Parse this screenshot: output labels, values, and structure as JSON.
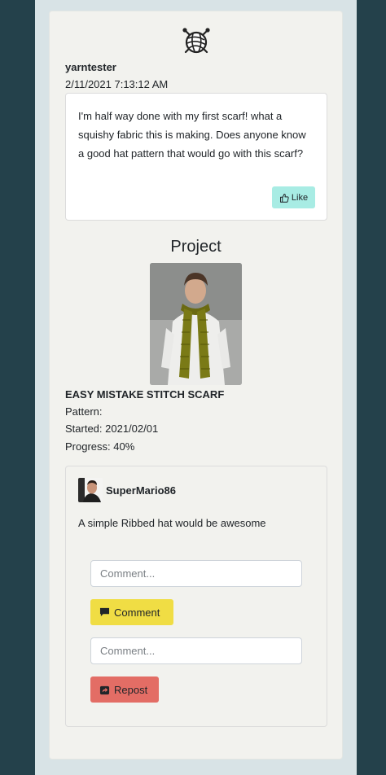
{
  "post": {
    "username": "yarntester",
    "timestamp": "2/11/2021 7:13:12 AM",
    "text": "I'm half way done with my first scarf! what a squishy fabric this is making. Does anyone know a good hat pattern that would go with this scarf?",
    "like_label": "Like",
    "like_icon": "thumbs-up-icon",
    "logo_icon": "yarn-ball-logo-icon"
  },
  "project": {
    "heading": "Project",
    "title": "EASY MISTAKE STITCH SCARF",
    "pattern": "Pattern:",
    "started": "Started: 2021/02/01",
    "progress": "Progress: 40%",
    "progress_value": 0.4
  },
  "comment": {
    "username": "SuperMario86",
    "text": "A simple Ribbed hat would be awesome",
    "comment_placeholder": "Comment...",
    "comment_button": "Comment",
    "comment_icon": "speech-bubble-icon",
    "repost_placeholder": "Comment...",
    "repost_button": "Repost",
    "repost_icon": "share-icon"
  },
  "colors": {
    "page_background": "#24414b",
    "like_button": "#a8ece4",
    "comment_button": "#f0dd44",
    "repost_button": "#e36d65"
  }
}
